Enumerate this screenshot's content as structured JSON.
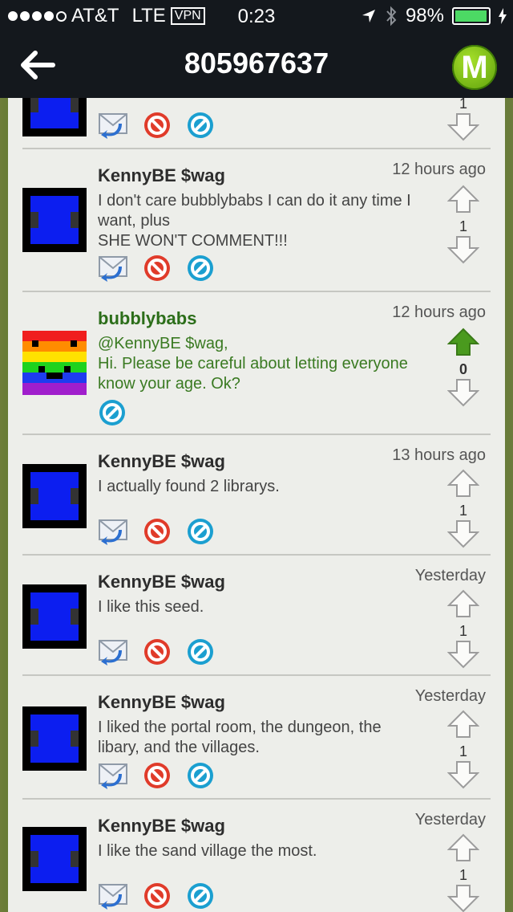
{
  "status": {
    "carrier": "AT&T",
    "network": "LTE",
    "vpn": "VPN",
    "time": "0:23",
    "battery": "98%",
    "battery_fraction": 0.98
  },
  "header": {
    "title": "805967637",
    "logo_letter": "M"
  },
  "posts": [
    {
      "name": "",
      "time": "",
      "text": "",
      "count": "1"
    },
    {
      "name": "KennyBE $wag",
      "time": "12 hours ago",
      "text": "I don't care bubblybabs I can do it any time I want, plus\nSHE WON'T COMMENT!!!",
      "count": "1"
    },
    {
      "name": "bubblybabs",
      "time": "12 hours ago",
      "text": "@KennyBE $wag,\nHi. Please be careful about letting everyone know your age. Ok?",
      "count": "0"
    },
    {
      "name": "KennyBE $wag",
      "time": "13 hours ago",
      "text": "I actually found 2 librarys.",
      "count": "1"
    },
    {
      "name": "KennyBE $wag",
      "time": "Yesterday",
      "text": "I like this seed.",
      "count": "1"
    },
    {
      "name": "KennyBE $wag",
      "time": "Yesterday",
      "text": "I liked the portal room, the dungeon, the libary, and the villages.",
      "count": "1"
    },
    {
      "name": "KennyBE $wag",
      "time": "Yesterday",
      "text": "I like the sand village the most.",
      "count": "1"
    }
  ],
  "colors": {
    "accent_green": "#2c6e1a",
    "upvote_active": "#4a9a1e",
    "report": "#e03b2a",
    "block": "#1b9fd0"
  }
}
